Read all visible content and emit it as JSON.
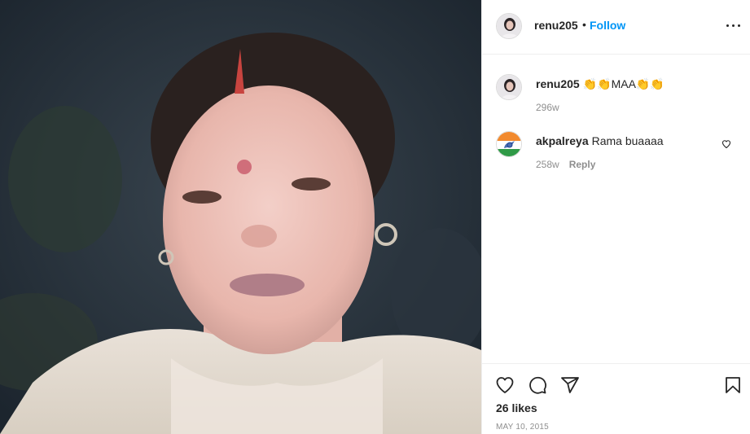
{
  "post": {
    "username": "renu205",
    "separator": "•",
    "follow_label": "Follow",
    "more_icon": "more-options-icon",
    "photo_alt": "Post photo"
  },
  "comments": [
    {
      "username": "renu205",
      "text": "👏👏MAA👏👏",
      "age": "296w",
      "reply_label": ""
    },
    {
      "username": "akpalreya",
      "text": "Rama buaaaa",
      "age": "258w",
      "reply_label": "Reply"
    }
  ],
  "actions": {
    "icons": [
      "heart-icon",
      "comment-icon",
      "share-icon",
      "bookmark-icon"
    ],
    "likes": "26 likes",
    "date": "MAY 10, 2015"
  },
  "colors": {
    "link": "#0095f6",
    "text": "#262626",
    "muted": "#8e8e8e",
    "border": "#efefef"
  }
}
